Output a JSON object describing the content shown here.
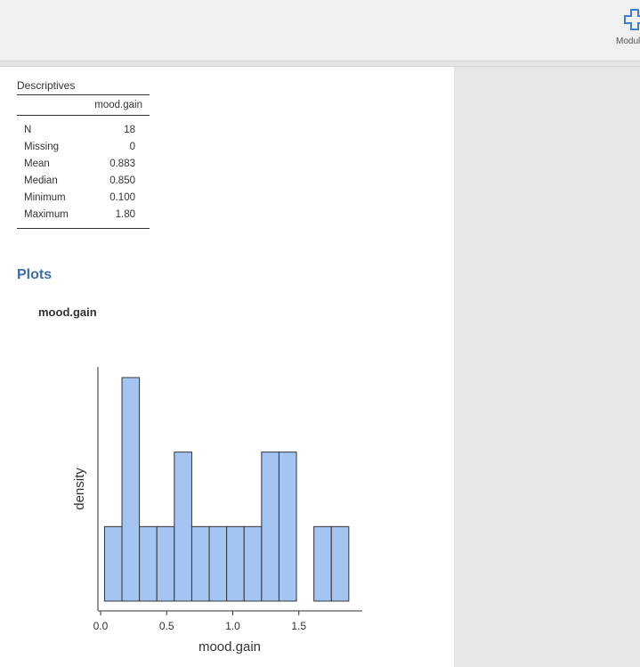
{
  "toolbar": {
    "modules_label": "Modules",
    "modules_icon": "plus-icon",
    "accent_color": "#3e7bd3"
  },
  "descriptives": {
    "title": "Descriptives",
    "column": "mood.gain",
    "rows": [
      {
        "label": "N",
        "value": "18"
      },
      {
        "label": "Missing",
        "value": "0"
      },
      {
        "label": "Mean",
        "value": "0.883"
      },
      {
        "label": "Median",
        "value": "0.850"
      },
      {
        "label": "Minimum",
        "value": "0.100"
      },
      {
        "label": "Maximum",
        "value": "1.80"
      }
    ]
  },
  "plots": {
    "heading": "Plots",
    "plot_title": "mood.gain"
  },
  "chart_data": {
    "type": "bar",
    "xlabel": "mood.gain",
    "ylabel": "density",
    "bar_color": "#a4c4f2",
    "xlim": [
      -0.02,
      1.98
    ],
    "x_ticks": [
      "0.0",
      "0.5",
      "1.0",
      "1.5"
    ],
    "x_tick_values": [
      0.0,
      0.5,
      1.0,
      1.5
    ],
    "bin_width": 0.132,
    "bins": [
      {
        "start": 0.03,
        "count": 1
      },
      {
        "start": 0.162,
        "count": 3
      },
      {
        "start": 0.294,
        "count": 1
      },
      {
        "start": 0.426,
        "count": 1
      },
      {
        "start": 0.558,
        "count": 2
      },
      {
        "start": 0.69,
        "count": 1
      },
      {
        "start": 0.822,
        "count": 1
      },
      {
        "start": 0.954,
        "count": 1
      },
      {
        "start": 1.086,
        "count": 1
      },
      {
        "start": 1.218,
        "count": 2
      },
      {
        "start": 1.35,
        "count": 2
      },
      {
        "start": 1.482,
        "count": 0
      },
      {
        "start": 1.614,
        "count": 1
      },
      {
        "start": 1.746,
        "count": 1
      }
    ],
    "ylim": [
      0,
      3.1
    ]
  }
}
